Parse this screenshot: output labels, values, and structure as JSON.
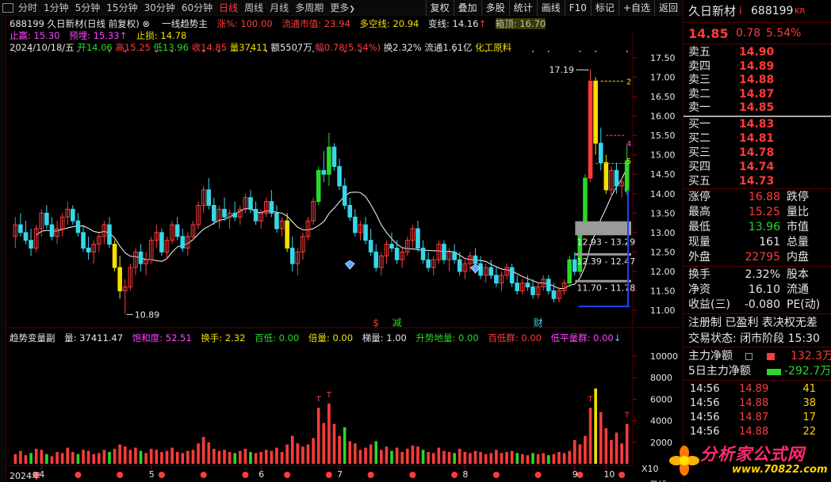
{
  "toolbar": {
    "periods": [
      "分时",
      "1分钟",
      "5分钟",
      "15分钟",
      "30分钟",
      "60分钟",
      "日线",
      "周线",
      "月线",
      "多周期",
      "更多"
    ],
    "active_period": "日线",
    "more_arrow": "❯",
    "buttons": [
      "复权",
      "叠加",
      "多股",
      "统计",
      "画线",
      "F10",
      "标记",
      "+自选",
      "返回"
    ]
  },
  "header": {
    "line1": {
      "title": "688199 久日新材(日线 前复权)",
      "indicator_name": "一线趋势主",
      "rise_label": "涨%: 100.00",
      "float_cap": "流通市值: 23.94",
      "long_short": "多空线: 20.94",
      "change_line": "变线: 14.16",
      "box_top": "箱顶: 16.70"
    },
    "line2": {
      "take_profit": "止赢: 15.30",
      "forecast": "预埋: 15.33",
      "stop_loss": "止损: 14.78"
    },
    "line3": {
      "date": "2024/10/18/五",
      "open": "开14.06",
      "high": "高15.25",
      "low": "低13.96",
      "close": "收14.85",
      "volume": "量37411",
      "amount": "额5507万",
      "range": "幅0.78(5.54%)",
      "turnover": "换2.32%",
      "float": "流通1.61亿",
      "industry": "化工原料"
    }
  },
  "chart_data": {
    "type": "candlestick",
    "y_ticks": [
      "17.50",
      "17.00",
      "16.50",
      "16.00",
      "15.50",
      "15.00",
      "14.50",
      "14.00",
      "13.50",
      "13.00",
      "12.50",
      "12.00",
      "11.50",
      "11.00"
    ],
    "ylim": [
      11.0,
      17.5
    ],
    "x_labels": [
      "2024年",
      "4",
      "5",
      "6",
      "7",
      "8",
      "9",
      "10"
    ],
    "annotations": {
      "high_mark": "17.19",
      "low_mark": "10.89",
      "level_2": "2",
      "level_4": "4",
      "level_5": "5",
      "zone_1": "12.93 - 13.29",
      "zone_2": "12.39 - 12.47",
      "zone_3": "11.70 - 11.78",
      "event_s": "$",
      "event_reduce": "减",
      "event_finance": "财"
    },
    "colors": {
      "up": "#ff3b3b",
      "down": "#38d6e8",
      "ma": "#ffffff",
      "big_up": "#29d829",
      "yellow": "#f5e000"
    },
    "ohlc": [
      [
        12.9,
        13.4,
        12.6,
        13.2
      ],
      [
        13.2,
        13.5,
        12.9,
        13.0
      ],
      [
        13.0,
        13.3,
        12.7,
        12.8
      ],
      [
        12.8,
        13.1,
        12.4,
        12.6
      ],
      [
        12.6,
        13.2,
        12.5,
        13.1
      ],
      [
        13.1,
        13.6,
        12.9,
        13.5
      ],
      [
        13.5,
        13.7,
        13.1,
        13.2
      ],
      [
        13.2,
        13.4,
        12.8,
        12.9
      ],
      [
        12.9,
        13.3,
        12.7,
        13.1
      ],
      [
        13.1,
        13.5,
        12.9,
        13.4
      ],
      [
        13.4,
        13.8,
        13.2,
        13.6
      ],
      [
        13.6,
        13.7,
        13.2,
        13.3
      ],
      [
        13.3,
        13.5,
        12.9,
        13.0
      ],
      [
        13.0,
        13.2,
        12.5,
        12.6
      ],
      [
        12.6,
        12.9,
        12.3,
        12.5
      ],
      [
        12.5,
        12.8,
        12.2,
        12.7
      ],
      [
        12.7,
        13.0,
        12.5,
        12.9
      ],
      [
        12.9,
        13.3,
        12.7,
        13.2
      ],
      [
        13.2,
        13.4,
        12.6,
        12.7
      ],
      [
        12.7,
        12.8,
        12.0,
        12.1
      ],
      [
        12.1,
        12.4,
        11.3,
        11.5
      ],
      [
        11.5,
        11.8,
        10.89,
        11.6
      ],
      [
        11.6,
        12.2,
        11.5,
        12.1
      ],
      [
        12.1,
        12.6,
        11.9,
        12.5
      ],
      [
        12.5,
        12.7,
        12.0,
        12.2
      ],
      [
        12.2,
        12.5,
        11.9,
        12.3
      ],
      [
        12.3,
        12.9,
        12.2,
        12.8
      ],
      [
        12.8,
        13.2,
        12.6,
        13.0
      ],
      [
        13.0,
        13.1,
        12.4,
        12.5
      ],
      [
        12.5,
        12.9,
        12.3,
        12.8
      ],
      [
        12.8,
        13.3,
        12.7,
        13.2
      ],
      [
        13.2,
        13.4,
        12.8,
        12.9
      ],
      [
        12.9,
        13.1,
        12.5,
        12.6
      ],
      [
        12.6,
        13.0,
        12.4,
        12.9
      ],
      [
        12.9,
        13.3,
        12.8,
        13.2
      ],
      [
        13.2,
        13.8,
        13.1,
        13.7
      ],
      [
        13.7,
        14.2,
        13.5,
        14.1
      ],
      [
        14.1,
        14.4,
        13.6,
        13.7
      ],
      [
        13.7,
        13.9,
        13.2,
        13.3
      ],
      [
        13.3,
        13.7,
        13.1,
        13.6
      ],
      [
        13.6,
        13.9,
        13.3,
        13.4
      ],
      [
        13.4,
        13.6,
        13.1,
        13.5
      ],
      [
        13.5,
        13.8,
        13.3,
        13.4
      ],
      [
        13.4,
        13.7,
        13.2,
        13.6
      ],
      [
        13.6,
        14.0,
        13.5,
        13.9
      ],
      [
        13.9,
        14.1,
        13.5,
        13.6
      ],
      [
        13.6,
        13.8,
        13.2,
        13.3
      ],
      [
        13.3,
        13.6,
        13.1,
        13.5
      ],
      [
        13.5,
        13.9,
        13.4,
        13.8
      ],
      [
        13.8,
        14.1,
        13.4,
        13.5
      ],
      [
        13.5,
        13.7,
        13.0,
        13.1
      ],
      [
        13.1,
        13.4,
        12.9,
        13.3
      ],
      [
        13.3,
        13.5,
        12.5,
        12.6
      ],
      [
        12.6,
        12.9,
        12.0,
        12.2
      ],
      [
        12.2,
        12.6,
        11.9,
        12.5
      ],
      [
        12.5,
        13.0,
        12.3,
        12.9
      ],
      [
        12.9,
        13.4,
        12.8,
        13.3
      ],
      [
        13.3,
        13.9,
        13.2,
        13.8
      ],
      [
        13.8,
        14.7,
        13.7,
        14.6
      ],
      [
        14.6,
        15.1,
        14.3,
        14.5
      ],
      [
        14.5,
        15.57,
        14.2,
        15.2
      ],
      [
        15.2,
        15.3,
        14.6,
        14.7
      ],
      [
        14.7,
        14.9,
        14.1,
        14.2
      ],
      [
        14.2,
        14.4,
        13.6,
        13.7
      ],
      [
        13.7,
        13.9,
        13.3,
        13.4
      ],
      [
        13.4,
        13.6,
        12.9,
        13.0
      ],
      [
        13.0,
        13.3,
        12.8,
        13.2
      ],
      [
        13.2,
        13.4,
        12.7,
        12.8
      ],
      [
        12.8,
        13.1,
        12.4,
        12.5
      ],
      [
        12.5,
        12.7,
        12.0,
        12.1
      ],
      [
        12.1,
        12.5,
        11.9,
        12.4
      ],
      [
        12.4,
        12.8,
        12.2,
        12.7
      ],
      [
        12.7,
        13.0,
        12.5,
        12.6
      ],
      [
        12.6,
        12.8,
        12.2,
        12.3
      ],
      [
        12.3,
        12.6,
        12.1,
        12.5
      ],
      [
        12.5,
        12.9,
        12.4,
        12.8
      ],
      [
        12.8,
        13.2,
        12.6,
        13.1
      ],
      [
        13.1,
        13.3,
        12.5,
        12.6
      ],
      [
        12.6,
        12.8,
        12.2,
        12.3
      ],
      [
        12.3,
        12.5,
        12.0,
        12.1
      ],
      [
        12.1,
        12.4,
        11.9,
        12.3
      ],
      [
        12.3,
        12.8,
        12.2,
        12.7
      ],
      [
        12.7,
        12.8,
        12.2,
        12.3
      ],
      [
        12.3,
        12.6,
        12.0,
        12.5
      ],
      [
        12.5,
        12.7,
        12.2,
        12.3
      ],
      [
        12.3,
        12.5,
        11.9,
        12.0
      ],
      [
        12.0,
        12.3,
        11.8,
        12.2
      ],
      [
        12.2,
        12.5,
        12.0,
        12.4
      ],
      [
        12.4,
        12.6,
        12.1,
        12.2
      ],
      [
        12.2,
        12.4,
        11.8,
        11.9
      ],
      [
        11.9,
        12.2,
        11.7,
        12.1
      ],
      [
        12.1,
        12.3,
        11.8,
        11.9
      ],
      [
        11.9,
        12.1,
        11.6,
        11.7
      ],
      [
        11.7,
        12.0,
        11.5,
        11.9
      ],
      [
        11.9,
        12.2,
        11.8,
        12.1
      ],
      [
        12.1,
        12.2,
        11.6,
        11.7
      ],
      [
        11.7,
        11.9,
        11.4,
        11.5
      ],
      [
        11.5,
        11.8,
        11.4,
        11.7
      ],
      [
        11.7,
        11.9,
        11.5,
        11.6
      ],
      [
        11.6,
        11.8,
        11.3,
        11.4
      ],
      [
        11.4,
        11.7,
        11.3,
        11.6
      ],
      [
        11.6,
        11.9,
        11.5,
        11.8
      ],
      [
        11.8,
        11.9,
        11.4,
        11.5
      ],
      [
        11.5,
        11.7,
        11.2,
        11.3
      ],
      [
        11.3,
        11.6,
        11.2,
        11.5
      ],
      [
        11.5,
        11.8,
        11.4,
        11.7
      ],
      [
        11.7,
        12.4,
        11.6,
        12.3
      ],
      [
        12.3,
        12.5,
        11.9,
        12.0
      ],
      [
        12.0,
        13.3,
        11.9,
        13.2
      ],
      [
        13.2,
        14.5,
        13.1,
        14.4
      ],
      [
        14.4,
        17.19,
        14.3,
        16.9
      ],
      [
        16.9,
        17.0,
        15.0,
        15.3
      ],
      [
        15.3,
        15.7,
        14.6,
        14.8
      ],
      [
        14.8,
        15.0,
        14.0,
        14.1
      ],
      [
        14.1,
        14.7,
        13.9,
        14.6
      ],
      [
        14.6,
        14.8,
        14.0,
        14.2
      ],
      [
        14.2,
        14.4,
        13.9,
        14.3
      ],
      [
        14.06,
        15.25,
        13.96,
        14.85
      ]
    ],
    "volume_ylim": [
      0,
      10000
    ],
    "volume_ticks": [
      "10000",
      "8000",
      "6000",
      "4000",
      "2000"
    ],
    "volume": [
      900,
      1200,
      800,
      1000,
      1400,
      1300,
      900,
      700,
      1100,
      1000,
      1500,
      1100,
      900,
      1300,
      1200,
      900,
      1000,
      1300,
      1100,
      1400,
      1800,
      1600,
      1300,
      1500,
      1200,
      1000,
      1400,
      1300,
      1100,
      1200,
      1500,
      1100,
      1000,
      1200,
      1300,
      1900,
      2500,
      2000,
      1400,
      1200,
      1300,
      1100,
      1000,
      1200,
      1400,
      1100,
      1000,
      1100,
      1300,
      1200,
      1500,
      1100,
      1800,
      2600,
      1900,
      1600,
      1800,
      2400,
      5200,
      3800,
      5600,
      3700,
      2600,
      3400,
      2100,
      1900,
      1300,
      1500,
      1800,
      2100,
      1300,
      1600,
      1200,
      1500,
      1100,
      1400,
      1700,
      1600,
      1300,
      1100,
      1000,
      1500,
      1200,
      1100,
      1000,
      1400,
      1100,
      1000,
      1200,
      1100,
      900,
      1000,
      1300,
      1000,
      1100,
      1200,
      1000,
      900,
      800,
      1000,
      900,
      1000,
      800,
      900,
      1100,
      1000,
      1200,
      2200,
      1800,
      2600,
      5200,
      7000,
      4800,
      3300,
      2200,
      2900,
      1900,
      3700
    ]
  },
  "sub_header": {
    "name": "趋势变量副",
    "volume": "量: 37411.47",
    "saturation": "饱和度: 52.51",
    "turnover": "换手: 2.32",
    "hundred_low": "百低: 0.00",
    "double_vol": "倍量: 0.00",
    "ladder": "梯量: 1.00",
    "uptrend": "升势地量: 0.00",
    "hundred_low_2": "百低群: 0.00",
    "low_flat": "低平量群: 0.00"
  },
  "bottom_axis": {
    "left_label": "2024年",
    "corner": "X10",
    "right_label": "日线"
  },
  "quote": {
    "name": "久日新材",
    "marker": "i",
    "code": "688199",
    "badge": "KR",
    "price": "14.85",
    "change": "0.78",
    "pct": "5.54%",
    "asks": [
      {
        "label": "卖五",
        "price": "14.90"
      },
      {
        "label": "卖四",
        "price": "14.89"
      },
      {
        "label": "卖三",
        "price": "14.88"
      },
      {
        "label": "卖二",
        "price": "14.87"
      },
      {
        "label": "卖一",
        "price": "14.85"
      }
    ],
    "bids": [
      {
        "label": "买一",
        "price": "14.83"
      },
      {
        "label": "买二",
        "price": "14.81"
      },
      {
        "label": "买三",
        "price": "14.78"
      },
      {
        "label": "买四",
        "price": "14.74"
      },
      {
        "label": "买五",
        "price": "14.73"
      }
    ],
    "stats": [
      {
        "l1": "涨停",
        "v1": "16.88",
        "l2": "跌停"
      },
      {
        "l1": "最高",
        "v1": "15.25",
        "l2": "量比"
      },
      {
        "l1": "最低",
        "v1": "13.96",
        "l2": "市值"
      },
      {
        "l1": "现量",
        "v1": "161",
        "l2": "总量"
      },
      {
        "l1": "外盘",
        "v1": "22795",
        "l2": "内盘"
      }
    ],
    "stats2": [
      {
        "l1": "换手",
        "v1": "2.32%",
        "l2": "股本"
      },
      {
        "l1": "净资",
        "v1": "16.10",
        "l2": "流通"
      },
      {
        "l1": "收益(三)",
        "v1": "-0.080",
        "l2": "PE(动)"
      }
    ],
    "info_line1": "注册制 已盈利 表决权无差",
    "info_line2": "交易状态: 闭市阶段 15:30",
    "main_net": "主力净额",
    "main_net_val": "132.3万",
    "main_net5": "5日主力净额",
    "main_net5_val": "-292.7万",
    "ticks": [
      {
        "time": "14:56",
        "price": "14.89",
        "vol": "41"
      },
      {
        "time": "14:56",
        "price": "14.88",
        "vol": "38"
      },
      {
        "time": "14:56",
        "price": "14.87",
        "vol": "17"
      },
      {
        "time": "14:56",
        "price": "14.88",
        "vol": "22"
      }
    ]
  },
  "watermark": {
    "text": "分析家公式网",
    "url": "www.70822.com"
  }
}
